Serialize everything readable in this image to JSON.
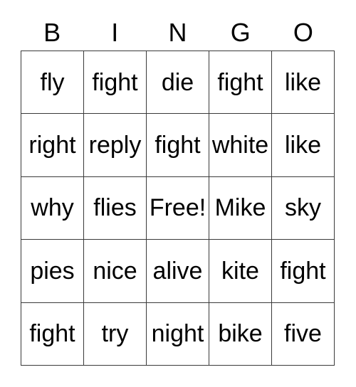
{
  "card": {
    "title": "BINGO",
    "columns": [
      "B",
      "I",
      "N",
      "G",
      "O"
    ],
    "free_space_label": "Free!",
    "colors": {
      "background": "#ffffff",
      "border": "#3a3a3a",
      "text": "#000000"
    },
    "rows": [
      {
        "cells": [
          "fly",
          "fight",
          "die",
          "fight",
          "like"
        ]
      },
      {
        "cells": [
          "right",
          "reply",
          "fight",
          "white",
          "like"
        ]
      },
      {
        "cells": [
          "why",
          "flies",
          "Free!",
          "Mike",
          "sky"
        ]
      },
      {
        "cells": [
          "pies",
          "nice",
          "alive",
          "kite",
          "fight"
        ]
      },
      {
        "cells": [
          "fight",
          "try",
          "night",
          "bike",
          "five"
        ]
      }
    ]
  }
}
